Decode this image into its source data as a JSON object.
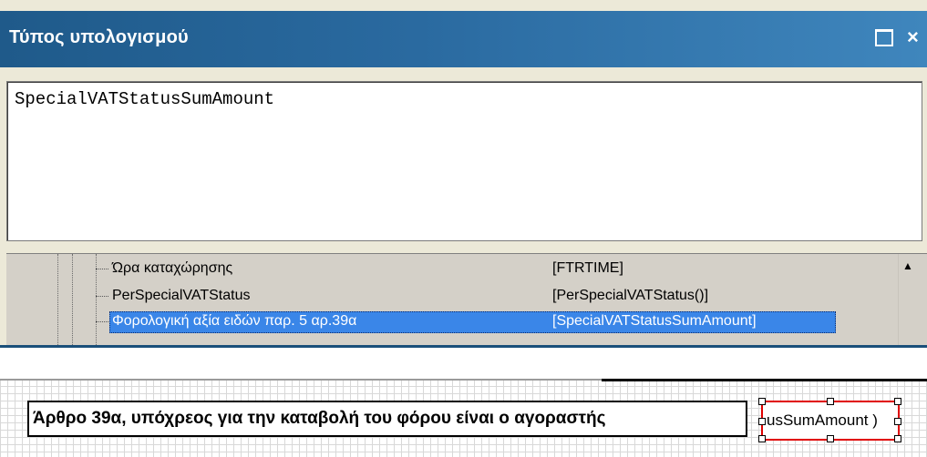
{
  "dialog": {
    "title": "Τύπος υπολογισμού",
    "maximize_icon": "maximize-icon",
    "close_label": "×",
    "formula": "SpecialVATStatusSumAmount"
  },
  "tree": {
    "rows": [
      {
        "name": "Ώρα καταχώρησης",
        "value": "[FTRTIME]"
      },
      {
        "name": "PerSpecialVATStatus",
        "value": "[PerSpecialVATStatus()]"
      },
      {
        "name": "Φορολογική αξία ειδών παρ. 5 αρ.39α",
        "value": "[SpecialVATStatusSumAmount]"
      }
    ],
    "scroll_up": "▲"
  },
  "designer": {
    "label": "Άρθρο 39α, υπόχρεος για την καταβολή του φόρου είναι ο αγοραστής",
    "field": "usSumAmount )"
  },
  "colors": {
    "titlebar": "#2a6aa0",
    "selection": "#3a86e8",
    "field_border": "#e00000"
  }
}
